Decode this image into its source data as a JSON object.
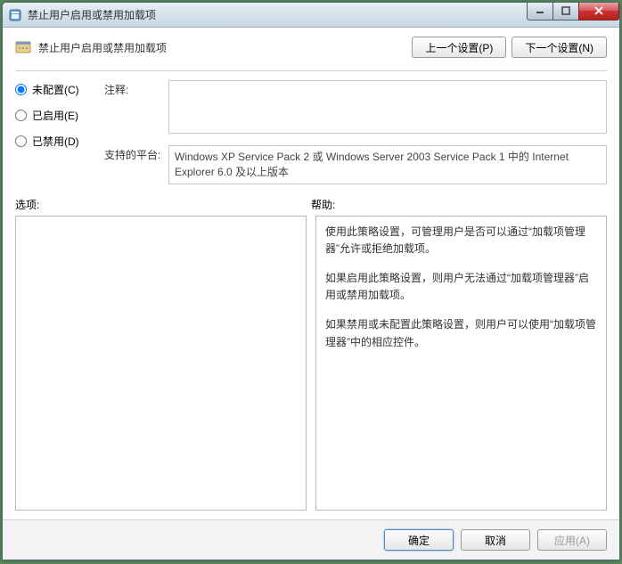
{
  "window": {
    "title": "禁止用户启用或禁用加载项"
  },
  "header": {
    "title": "禁止用户启用或禁用加载项",
    "prev_button": "上一个设置(P)",
    "next_button": "下一个设置(N)"
  },
  "radios": {
    "not_configured": "未配置(C)",
    "enabled": "已启用(E)",
    "disabled": "已禁用(D)",
    "selected": "not_configured"
  },
  "comment": {
    "label": "注释:",
    "value": ""
  },
  "platform": {
    "label": "支持的平台:",
    "text": "Windows XP Service Pack 2 或 Windows Server 2003 Service Pack 1 中的 Internet Explorer 6.0 及以上版本"
  },
  "lower": {
    "options_label": "选项:",
    "help_label": "帮助:"
  },
  "help": {
    "p1": "使用此策略设置，可管理用户是否可以通过“加载项管理器”允许或拒绝加载项。",
    "p2": "如果启用此策略设置，则用户无法通过“加载项管理器”启用或禁用加载项。",
    "p3": "如果禁用或未配置此策略设置，则用户可以使用“加载项管理器”中的相应控件。"
  },
  "footer": {
    "ok": "确定",
    "cancel": "取消",
    "apply": "应用(A)"
  }
}
